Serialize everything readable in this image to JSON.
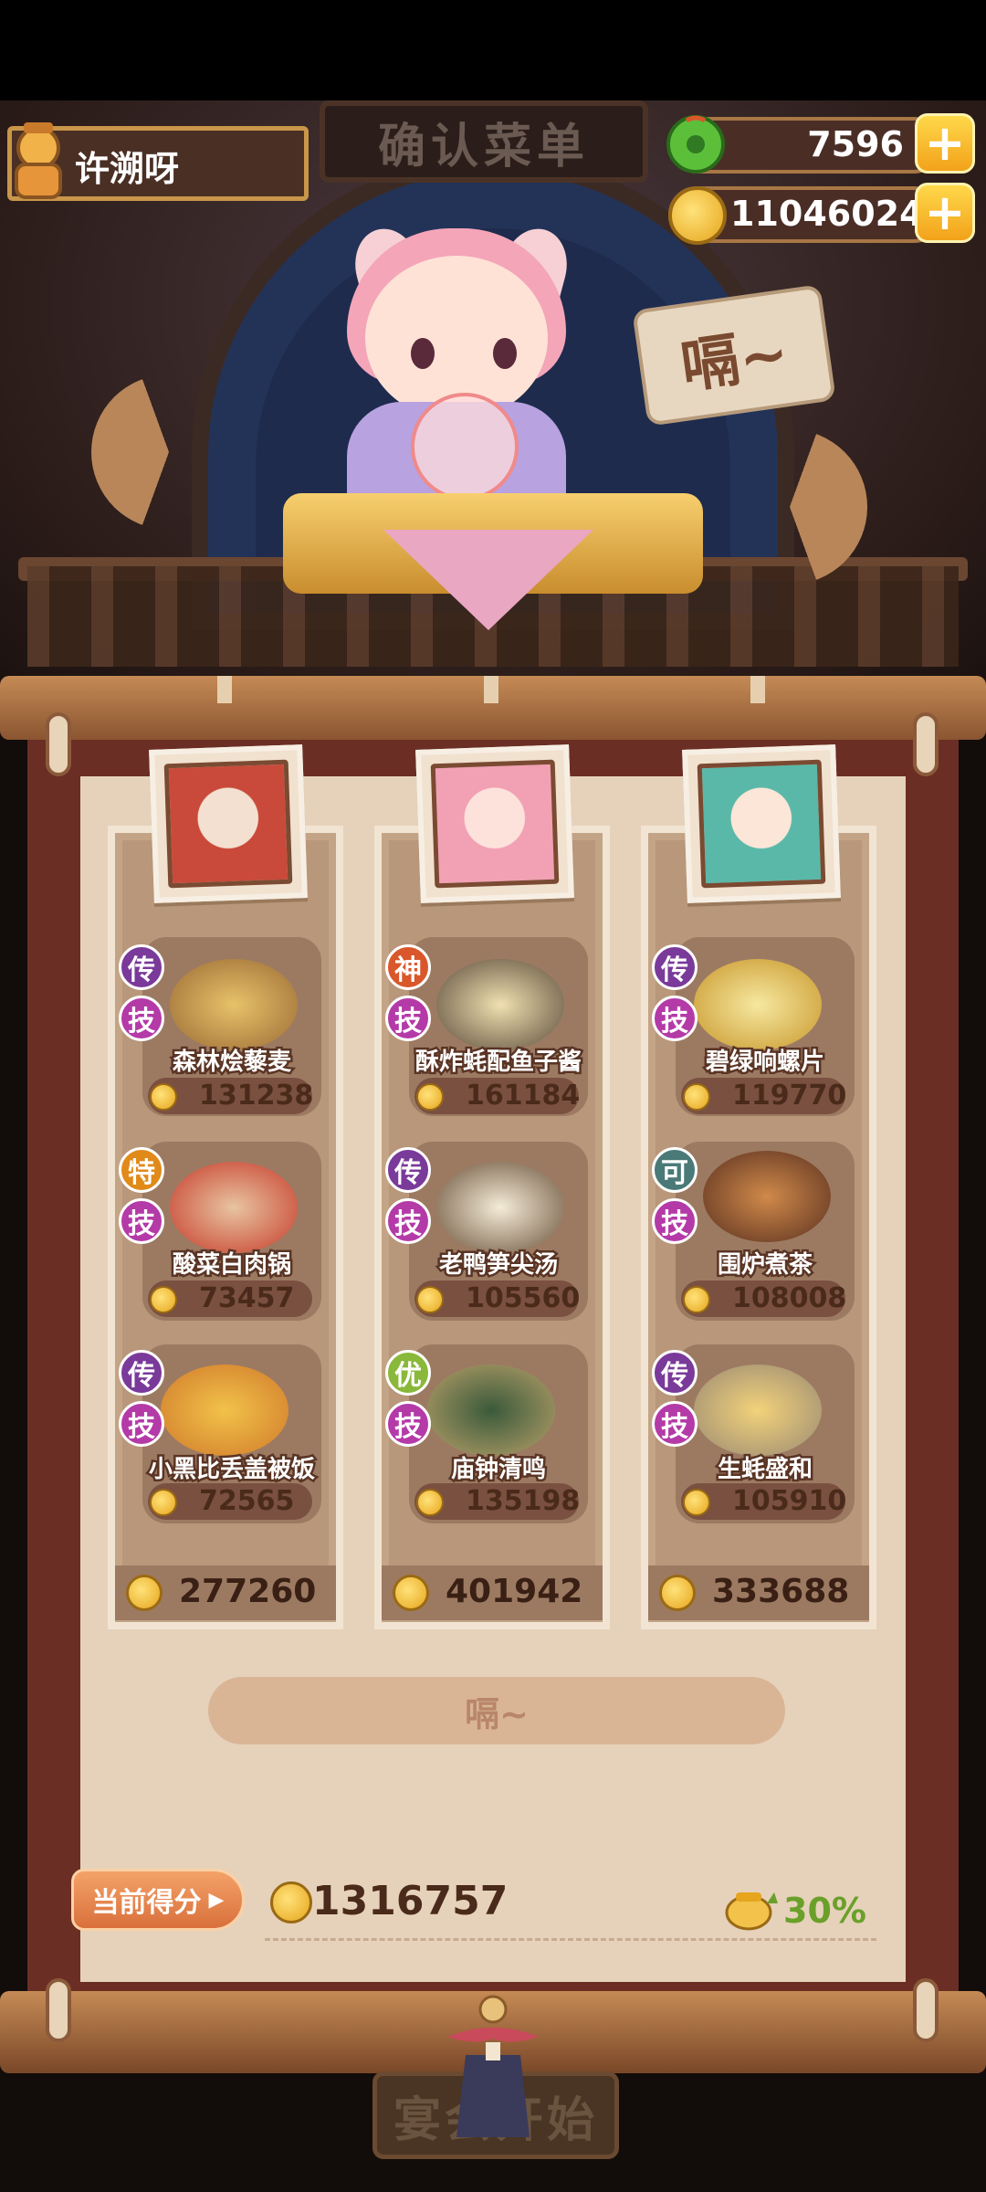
{
  "title": "确认菜单",
  "player": {
    "name": "许溯呀"
  },
  "currency": {
    "jade": "7596",
    "coins": "11046024",
    "jade_icon": "jade-icon",
    "coin_icon": "coin-icon"
  },
  "speech_text": "嗝~",
  "columns": [
    {
      "dishes": [
        {
          "rarity": "传",
          "skill": "技",
          "name": "森林烩藜麦",
          "price": "131238"
        },
        {
          "rarity": "特",
          "skill": "技",
          "name": "酸菜白肉锅",
          "price": "73457"
        },
        {
          "rarity": "传",
          "skill": "技",
          "name": "小黑比丢盖被饭",
          "price": "72565"
        }
      ],
      "total": "277260"
    },
    {
      "dishes": [
        {
          "rarity": "神",
          "skill": "技",
          "name": "酥炸蚝配鱼子酱",
          "price": "161184"
        },
        {
          "rarity": "传",
          "skill": "技",
          "name": "老鸭笋尖汤",
          "price": "105560"
        },
        {
          "rarity": "优",
          "skill": "技",
          "name": "庙钟清鸣",
          "price": "135198"
        }
      ],
      "total": "401942"
    },
    {
      "dishes": [
        {
          "rarity": "传",
          "skill": "技",
          "name": "碧绿响螺片",
          "price": "119770"
        },
        {
          "rarity": "可",
          "skill": "技",
          "name": "围炉煮茶",
          "price": "108008"
        },
        {
          "rarity": "传",
          "skill": "技",
          "name": "生蚝盛和",
          "price": "105910"
        }
      ],
      "total": "333688"
    }
  ],
  "action_button": "嗝~",
  "score": {
    "label": "当前得分",
    "value": "1316757",
    "bonus": "30%"
  },
  "start_button": "宴会开始",
  "colors": {
    "legendary_badge": "#7a3a9a",
    "divine_badge": "#d9572a",
    "special_badge": "#e08a1a",
    "excellent_badge": "#8ab83a",
    "ok_badge": "#4a7a78",
    "skill_badge": "#b43aa8"
  }
}
